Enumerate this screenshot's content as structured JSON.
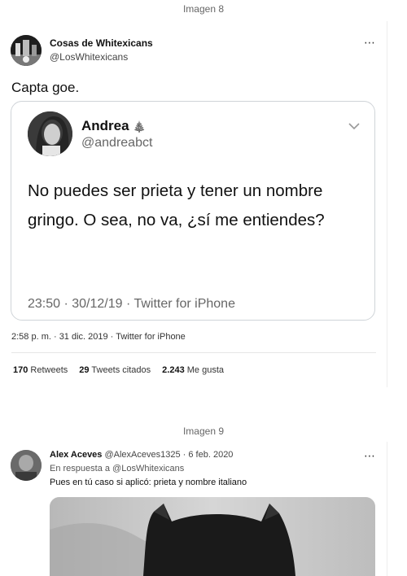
{
  "captions": {
    "first": "Imagen 8",
    "second": "Imagen 9"
  },
  "tweet": {
    "author_name": "Cosas de Whitexicans",
    "author_handle": "@LosWhitexicans",
    "text": "Capta goe.",
    "more_icon": "⋯",
    "timestamp": "2:58 p. m. · 31 dic. 2019 · Twitter for iPhone",
    "stats": {
      "retweets_count": "170",
      "retweets_label": "Retweets",
      "quotes_count": "29",
      "quotes_label": "Tweets citados",
      "likes_count": "2.243",
      "likes_label": "Me gusta"
    }
  },
  "quoted_tweet": {
    "author_name": "Andrea",
    "author_emoji": "🎄",
    "author_handle": "@andreabct",
    "text": "No puedes ser prieta y tener un nombre gringo. O sea, no va, ¿sí me entiendes?",
    "meta": "23:50 · 30/12/19 · Twitter for iPhone"
  },
  "reply_tweet": {
    "author_name": "Alex Aceves",
    "author_handle": "@AlexAceves1325",
    "date": "· 6 feb. 2020",
    "reply_to": "En respuesta a @LosWhitexicans",
    "text": "Pues en tú caso si aplicó: prieta y nombre italiano",
    "more_icon": "⋯"
  },
  "icons": {
    "more": "more-icon",
    "chevron": "chevron-down-icon",
    "tree": "christmas-tree-icon"
  }
}
